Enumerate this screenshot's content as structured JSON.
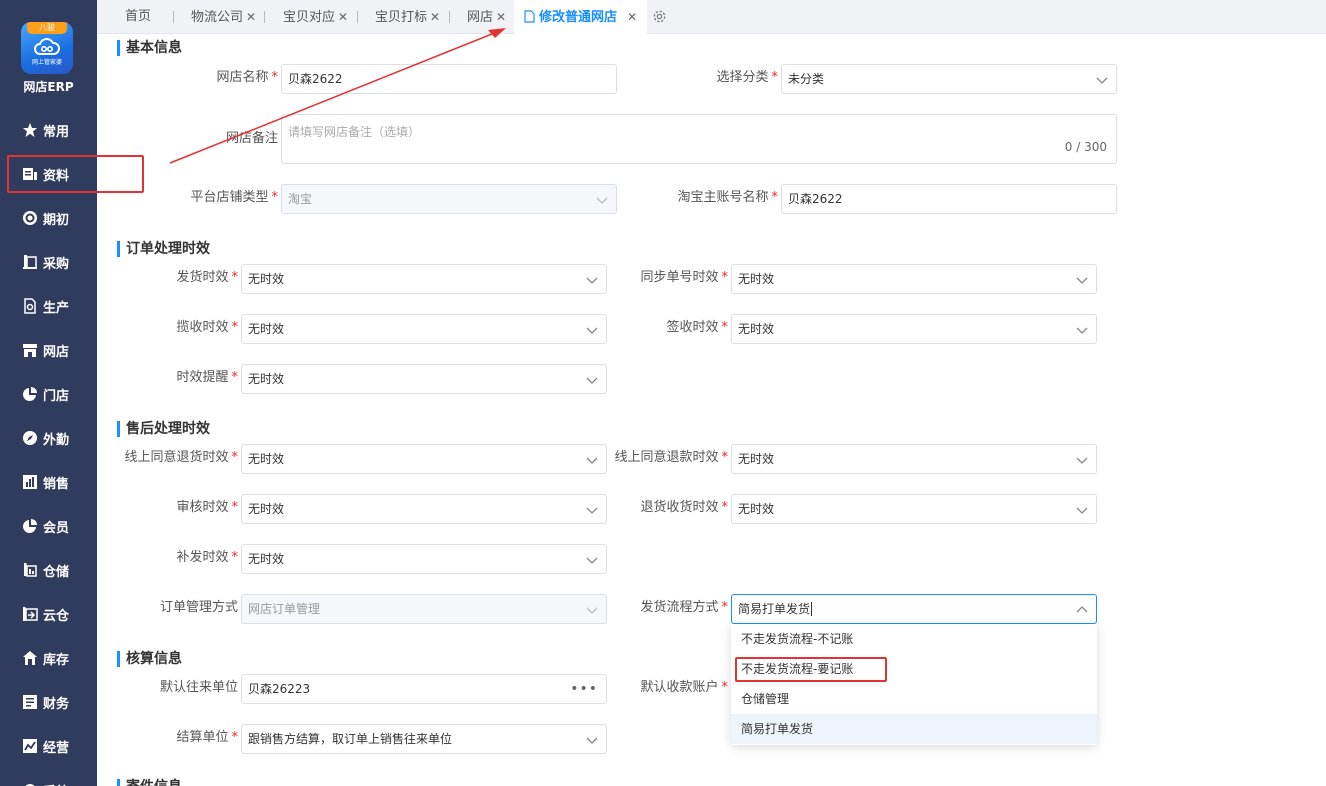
{
  "app": {
    "logo_tag": "八骏",
    "logo_sub": "网上管家婆",
    "brand": "网店ERP"
  },
  "sidebar": {
    "items": [
      {
        "label": "常用",
        "icon": "star-icon"
      },
      {
        "label": "资料",
        "icon": "document-icon"
      },
      {
        "label": "期初",
        "icon": "target-icon"
      },
      {
        "label": "采购",
        "icon": "book-icon"
      },
      {
        "label": "生产",
        "icon": "file-gear-icon"
      },
      {
        "label": "网店",
        "icon": "store-icon"
      },
      {
        "label": "门店",
        "icon": "pie-icon"
      },
      {
        "label": "外勤",
        "icon": "compass-icon"
      },
      {
        "label": "销售",
        "icon": "bar-chart-icon"
      },
      {
        "label": "会员",
        "icon": "pie-icon"
      },
      {
        "label": "仓储",
        "icon": "warehouse-icon"
      },
      {
        "label": "云仓",
        "icon": "cloud-warehouse-icon"
      },
      {
        "label": "库存",
        "icon": "home-icon"
      },
      {
        "label": "财务",
        "icon": "ledger-icon"
      },
      {
        "label": "经营",
        "icon": "trend-icon"
      },
      {
        "label": "系统",
        "icon": "settings-icon"
      }
    ]
  },
  "tabs": [
    {
      "label": "首页"
    },
    {
      "label": "物流公司"
    },
    {
      "label": "宝贝对应"
    },
    {
      "label": "宝贝打标"
    },
    {
      "label": "网店"
    },
    {
      "label": "修改普通网店"
    }
  ],
  "sections": {
    "basic": "基本信息",
    "order": "订单处理时效",
    "aftersale": "售后处理时效",
    "accounting": "核算信息",
    "next": "寄件信息"
  },
  "basic": {
    "shop_name_label": "网店名称",
    "shop_name": "贝森2622",
    "category_label": "选择分类",
    "category": "未分类",
    "remark_label": "网店备注",
    "remark_placeholder": "请填写网店备注（选填）",
    "remark_count": "0 / 300",
    "platform_label": "平台店铺类型",
    "platform": "淘宝",
    "main_account_label": "淘宝主账号名称",
    "main_account": "贝森2622"
  },
  "order": {
    "ship_label": "发货时效",
    "ship": "无时效",
    "sync_label": "同步单号时效",
    "sync": "无时效",
    "collect_label": "揽收时效",
    "collect": "无时效",
    "sign_label": "签收时效",
    "sign": "无时效",
    "remind_label": "时效提醒",
    "remind": "无时效"
  },
  "aftersale": {
    "return_agree_label": "线上同意退货时效",
    "return_agree": "无时效",
    "refund_agree_label": "线上同意退款时效",
    "refund_agree": "无时效",
    "audit_label": "审核时效",
    "audit": "无时效",
    "return_receive_label": "退货收货时效",
    "return_receive": "无时效",
    "reissue_label": "补发时效",
    "reissue": "无时效",
    "order_mgmt_label": "订单管理方式",
    "order_mgmt": "网店订单管理",
    "ship_flow_label": "发货流程方式",
    "ship_flow": "简易打单发货"
  },
  "ship_flow_options": [
    "不走发货流程-不记账",
    "不走发货流程-要记账",
    "仓储管理",
    "简易打单发货"
  ],
  "accounting": {
    "default_unit_label": "默认往来单位",
    "default_unit": "贝森26223",
    "default_account_label": "默认收款账户",
    "settle_label": "结算单位",
    "settle": "跟销售方结算，取订单上销售往来单位"
  },
  "colors": {
    "sidebar": "#2f3c5d",
    "accent": "#1890ff",
    "highlight": "#e23232"
  }
}
